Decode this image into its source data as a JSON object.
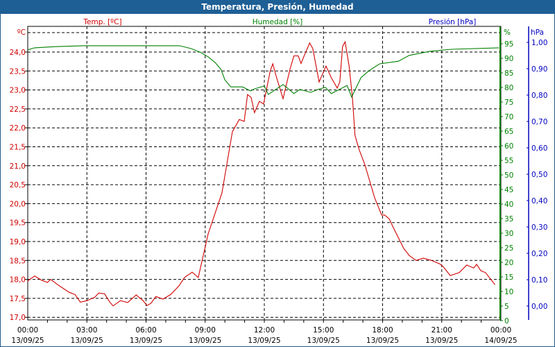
{
  "title": "Temperatura, Presión, Humedad",
  "colors": {
    "title_bar": "#1e5f96",
    "temperature": "#d00000",
    "humidity": "#008000",
    "pressure": "#0000c0"
  },
  "chart_data": {
    "type": "line",
    "title": "Temperatura, Presión, Humedad",
    "grid": true,
    "x_ticks": [
      {
        "time": "00:00",
        "date": "13/09/25"
      },
      {
        "time": "03:00",
        "date": "13/09/25"
      },
      {
        "time": "06:00",
        "date": "13/09/25"
      },
      {
        "time": "09:00",
        "date": "13/09/25"
      },
      {
        "time": "12:00",
        "date": "13/09/25"
      },
      {
        "time": "15:00",
        "date": "13/09/25"
      },
      {
        "time": "18:00",
        "date": "13/09/25"
      },
      {
        "time": "21:00",
        "date": "13/09/25"
      },
      {
        "time": "00:00",
        "date": "14/09/25"
      }
    ],
    "xlim_hours": [
      0,
      24
    ],
    "axes": {
      "temperature": {
        "label": "Temp. [ºC]",
        "unit": "ºC",
        "ylim": [
          17.0,
          24.5
        ],
        "ticks": [
          "17,0",
          "17,5",
          "18,0",
          "18,5",
          "19,0",
          "19,5",
          "20,0",
          "20,5",
          "21,0",
          "21,5",
          "22,0",
          "22,5",
          "23,0",
          "23,5",
          "24,0"
        ]
      },
      "humidity": {
        "label": "Humedad [%]",
        "unit": "%",
        "ylim": [
          0,
          99
        ],
        "ticks": [
          "0",
          "5",
          "10",
          "15",
          "20",
          "25",
          "30",
          "35",
          "40",
          "45",
          "50",
          "55",
          "60",
          "65",
          "70",
          "75",
          "80",
          "85",
          "90",
          "95"
        ]
      },
      "pressure": {
        "label": "Presión [hPa]",
        "unit": "hPa",
        "ylim": [
          -0.05,
          1.04
        ],
        "ticks": [
          "0,00",
          "0,10",
          "0,20",
          "0,30",
          "0,40",
          "0,50",
          "0,60",
          "0,70",
          "0,80",
          "0,90",
          "1,00"
        ]
      }
    },
    "series": [
      {
        "name": "Temp. [ºC]",
        "axis": "temperature",
        "points": [
          [
            0,
            17.96
          ],
          [
            0.35,
            18.09
          ],
          [
            0.7,
            17.98
          ],
          [
            1.0,
            17.92
          ],
          [
            1.16,
            18.0
          ],
          [
            1.55,
            17.85
          ],
          [
            2.1,
            17.66
          ],
          [
            2.4,
            17.6
          ],
          [
            2.67,
            17.4
          ],
          [
            3.0,
            17.44
          ],
          [
            3.4,
            17.53
          ],
          [
            3.6,
            17.64
          ],
          [
            3.9,
            17.62
          ],
          [
            4.15,
            17.41
          ],
          [
            4.33,
            17.3
          ],
          [
            4.7,
            17.44
          ],
          [
            5.07,
            17.39
          ],
          [
            5.5,
            17.59
          ],
          [
            5.85,
            17.44
          ],
          [
            6.05,
            17.31
          ],
          [
            6.25,
            17.37
          ],
          [
            6.5,
            17.55
          ],
          [
            6.86,
            17.48
          ],
          [
            7.25,
            17.6
          ],
          [
            7.67,
            17.83
          ],
          [
            7.95,
            18.05
          ],
          [
            8.34,
            18.19
          ],
          [
            8.65,
            18.05
          ],
          [
            8.87,
            18.56
          ],
          [
            9.15,
            19.2
          ],
          [
            9.85,
            20.28
          ],
          [
            10.2,
            21.34
          ],
          [
            10.38,
            21.9
          ],
          [
            10.73,
            22.22
          ],
          [
            10.98,
            22.17
          ],
          [
            11.15,
            22.88
          ],
          [
            11.33,
            22.8
          ],
          [
            11.5,
            22.4
          ],
          [
            11.75,
            22.7
          ],
          [
            11.96,
            22.63
          ],
          [
            12.3,
            23.5
          ],
          [
            12.43,
            23.69
          ],
          [
            12.6,
            23.36
          ],
          [
            12.95,
            22.77
          ],
          [
            13.3,
            23.54
          ],
          [
            13.5,
            23.9
          ],
          [
            13.72,
            23.9
          ],
          [
            13.86,
            23.7
          ],
          [
            14.07,
            23.96
          ],
          [
            14.3,
            24.24
          ],
          [
            14.46,
            24.09
          ],
          [
            14.78,
            23.21
          ],
          [
            15.13,
            23.63
          ],
          [
            15.4,
            23.32
          ],
          [
            15.7,
            23.05
          ],
          [
            15.83,
            23.21
          ],
          [
            15.97,
            24.15
          ],
          [
            16.1,
            24.27
          ],
          [
            16.3,
            23.63
          ],
          [
            16.47,
            22.8
          ],
          [
            16.6,
            21.8
          ],
          [
            16.8,
            21.44
          ],
          [
            17.1,
            21.03
          ],
          [
            17.6,
            20.15
          ],
          [
            17.95,
            19.7
          ],
          [
            18.1,
            19.7
          ],
          [
            18.33,
            19.6
          ],
          [
            18.58,
            19.33
          ],
          [
            19.07,
            18.82
          ],
          [
            19.35,
            18.63
          ],
          [
            19.7,
            18.5
          ],
          [
            20.06,
            18.56
          ],
          [
            20.48,
            18.5
          ],
          [
            20.9,
            18.41
          ],
          [
            21.1,
            18.32
          ],
          [
            21.43,
            18.1
          ],
          [
            21.89,
            18.18
          ],
          [
            22.27,
            18.38
          ],
          [
            22.62,
            18.3
          ],
          [
            22.77,
            18.4
          ],
          [
            22.98,
            18.23
          ],
          [
            23.22,
            18.18
          ],
          [
            23.7,
            17.86
          ]
        ]
      },
      {
        "name": "Humedad [%]",
        "axis": "humidity",
        "points": [
          [
            0,
            92.9
          ],
          [
            0.35,
            93.6
          ],
          [
            1.4,
            94.0
          ],
          [
            2.8,
            94.3
          ],
          [
            5.6,
            94.3
          ],
          [
            7.7,
            94.3
          ],
          [
            8.3,
            93.3
          ],
          [
            8.8,
            91.9
          ],
          [
            9.15,
            90.5
          ],
          [
            9.5,
            88.6
          ],
          [
            9.8,
            86.2
          ],
          [
            10.0,
            82.6
          ],
          [
            10.3,
            80.2
          ],
          [
            10.9,
            80.2
          ],
          [
            11.3,
            78.8
          ],
          [
            11.5,
            79.5
          ],
          [
            12.0,
            80.5
          ],
          [
            12.2,
            77.6
          ],
          [
            12.95,
            81.0
          ],
          [
            13.5,
            77.9
          ],
          [
            13.8,
            79.3
          ],
          [
            14.35,
            78.3
          ],
          [
            14.8,
            79.5
          ],
          [
            15.1,
            80.0
          ],
          [
            15.4,
            77.9
          ],
          [
            16.2,
            80.7
          ],
          [
            16.43,
            76.7
          ],
          [
            16.9,
            83.3
          ],
          [
            17.3,
            85.7
          ],
          [
            17.85,
            88.1
          ],
          [
            18.8,
            89.0
          ],
          [
            19.35,
            91.0
          ],
          [
            20.4,
            92.4
          ],
          [
            21.5,
            93.1
          ],
          [
            23.9,
            93.6
          ]
        ]
      }
    ]
  }
}
